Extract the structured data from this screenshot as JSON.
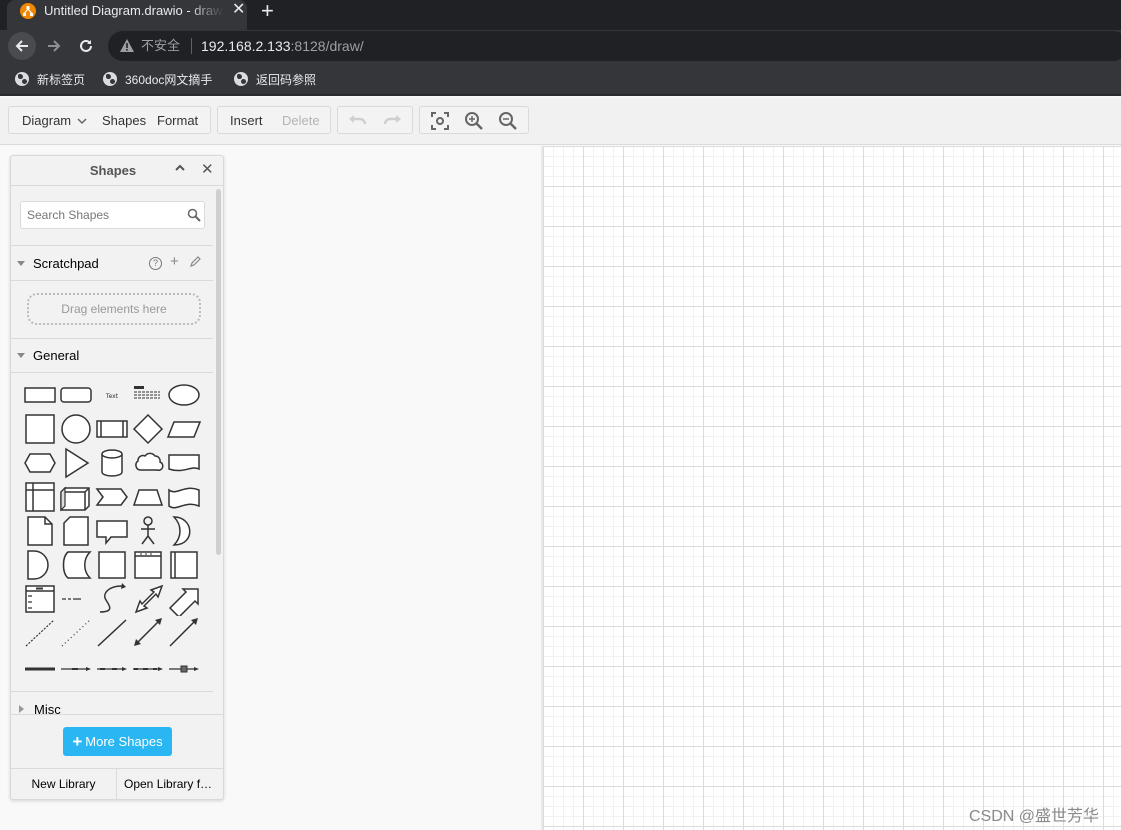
{
  "browser": {
    "tab_title": "Untitled Diagram.drawio - draw.io",
    "tab_close": "✕",
    "new_tab": "+",
    "security_label": "不安全",
    "url_host": "192.168.2.133",
    "url_rest": ":8128/draw/",
    "bookmarks": [
      {
        "label": "新标签页",
        "icon": "globe-icon"
      },
      {
        "label": "360doc网文摘手",
        "icon": "globe-icon"
      },
      {
        "label": "返回码参照",
        "icon": "globe-icon"
      }
    ]
  },
  "toolbar": {
    "diagram": "Diagram",
    "shapes": "Shapes",
    "format": "Format",
    "insert": "Insert",
    "delete": "Delete",
    "undo_enabled": false,
    "redo_enabled": false,
    "delete_enabled": false
  },
  "shapes_panel": {
    "title": "Shapes",
    "collapse_glyph": "^",
    "close_glyph": "✕",
    "search_placeholder": "Search Shapes",
    "scratchpad": {
      "label": "Scratchpad",
      "help": "?",
      "add": "+",
      "drop_hint": "Drag elements here"
    },
    "general": {
      "label": "General",
      "shapes": [
        "rectangle",
        "rounded-rectangle",
        "text",
        "textbox",
        "ellipse",
        "square",
        "circle",
        "process",
        "diamond",
        "parallelogram",
        "hexagon",
        "triangle",
        "cylinder",
        "cloud",
        "document",
        "internal-storage",
        "cube",
        "step",
        "trapezoid",
        "tape",
        "note",
        "card",
        "callout",
        "actor",
        "or",
        "and",
        "data-storage",
        "container",
        "container-titled",
        "container-vertical",
        "list",
        "list-item",
        "curve",
        "bidirectional-arrow",
        "arrow",
        "dashed-line",
        "dotted-line",
        "line",
        "bidirectional-connector",
        "directional-connector",
        "link",
        "connector-label",
        "connector-2-labels",
        "connector-3-labels",
        "connector-symbol"
      ]
    },
    "misc": {
      "label": "Misc"
    },
    "more_shapes": "More Shapes",
    "new_library": "New Library",
    "open_library": "Open Library from"
  },
  "canvas": {
    "grid": true
  },
  "watermark": "CSDN @盛世芳华"
}
